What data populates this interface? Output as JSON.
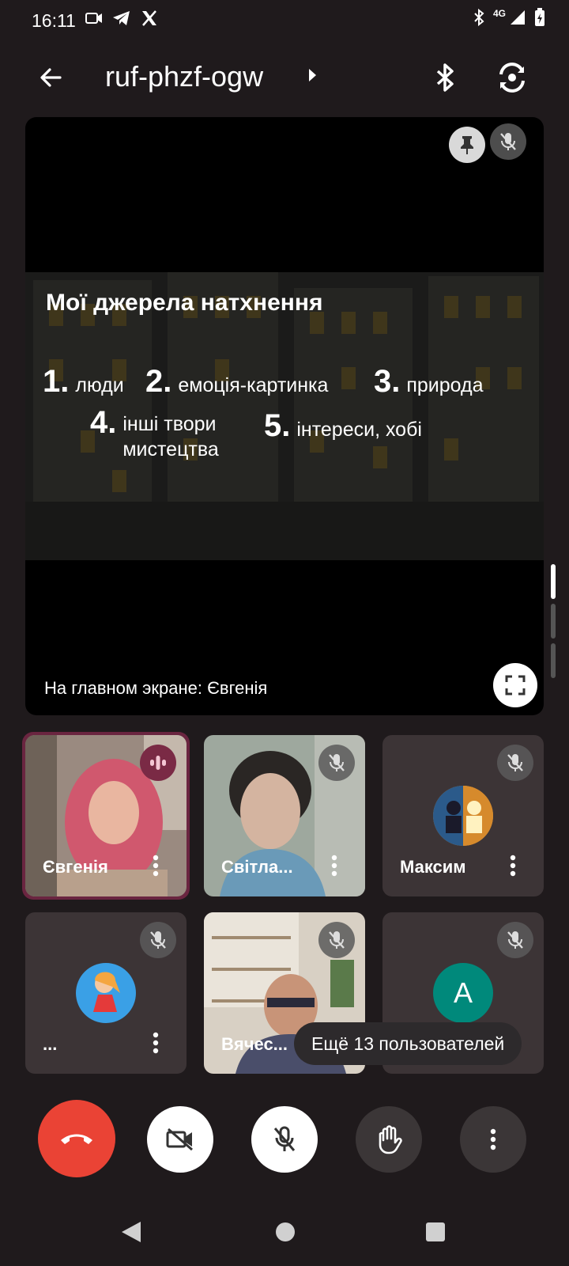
{
  "status_bar": {
    "time": "16:11",
    "network": "4G"
  },
  "header": {
    "meeting_code": "ruf-phzf-ogw"
  },
  "main_stage": {
    "slide_title": "Мої джерела натхнення",
    "items": [
      {
        "num": "1.",
        "text": "люди"
      },
      {
        "num": "2.",
        "text": "емоція-картинка"
      },
      {
        "num": "3.",
        "text": "природа"
      },
      {
        "num": "4.",
        "text": "інші твори мистецтва"
      },
      {
        "num": "5.",
        "text": "інтереси, хобі"
      }
    ],
    "caption": "На главном экране: Євгенія"
  },
  "participants": [
    {
      "name": "Євгенія",
      "state": "speaking"
    },
    {
      "name": "Світла...",
      "state": "muted"
    },
    {
      "name": "Максим",
      "state": "muted"
    },
    {
      "name": "...",
      "state": "muted"
    },
    {
      "name": "Вячес...",
      "state": "muted"
    },
    {
      "name": "",
      "state": "muted",
      "initial": "A"
    }
  ],
  "more_users_label": "Ещё 13 пользователей",
  "colors": {
    "background": "#1f1a1c",
    "tile": "#3c3436",
    "end_call": "#ea4335",
    "speaking_border": "#7a2a45",
    "avatar_teal": "#00897b"
  }
}
